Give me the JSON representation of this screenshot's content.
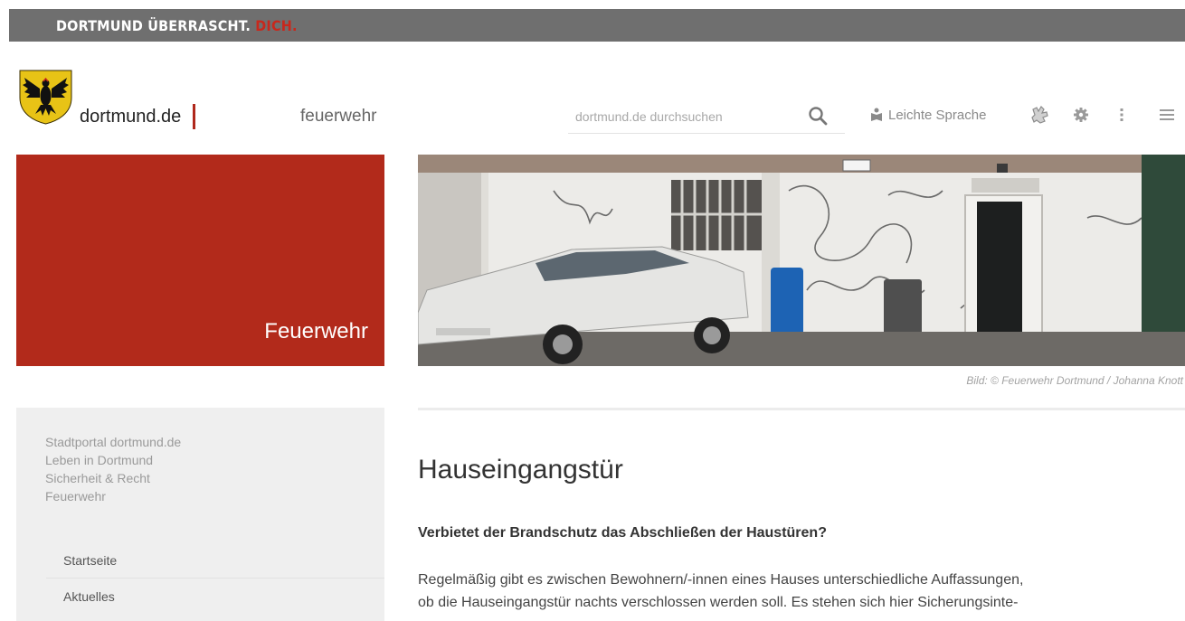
{
  "banner": {
    "text_main": "DORTMUND ÜBERRASCHT.",
    "text_accent": "DICH."
  },
  "header": {
    "logo_text": "dortmund.de",
    "section_name": "feuerwehr",
    "search": {
      "placeholder": "dortmund.de durchsuchen",
      "value": ""
    },
    "easy_language_label": "Leichte Sprache",
    "icons": [
      "search-icon",
      "easy-language-icon",
      "sign-language-icon",
      "gear-icon",
      "more-vert-icon",
      "menu-icon"
    ]
  },
  "feature": {
    "title": "Feuerwehr"
  },
  "hero": {
    "caption": "Bild: © Feuerwehr Dortmund / Johanna Knott"
  },
  "sidebar": {
    "breadcrumbs": [
      "Stadtportal dortmund.de",
      "Leben in Dortmund",
      "Sicherheit & Recht",
      "Feuerwehr"
    ],
    "nav": [
      "Startseite",
      "Aktuelles"
    ]
  },
  "article": {
    "title": "Hauseingangstür",
    "subtitle": "Verbietet der Brandschutz das Abschließen der Haustüren?",
    "body_lines": [
      "Regelmäßig gibt es zwischen Bewohnern/-innen eines Hauses unterschiedliche Auffassungen,",
      "ob die Hauseingangstür nachts verschlossen werden soll. Es stehen sich hier Sicherungsinte-"
    ]
  },
  "colors": {
    "brand_red": "#b22a1b",
    "banner_grey": "#6f6f6f",
    "sidebar_grey": "#efefef"
  }
}
